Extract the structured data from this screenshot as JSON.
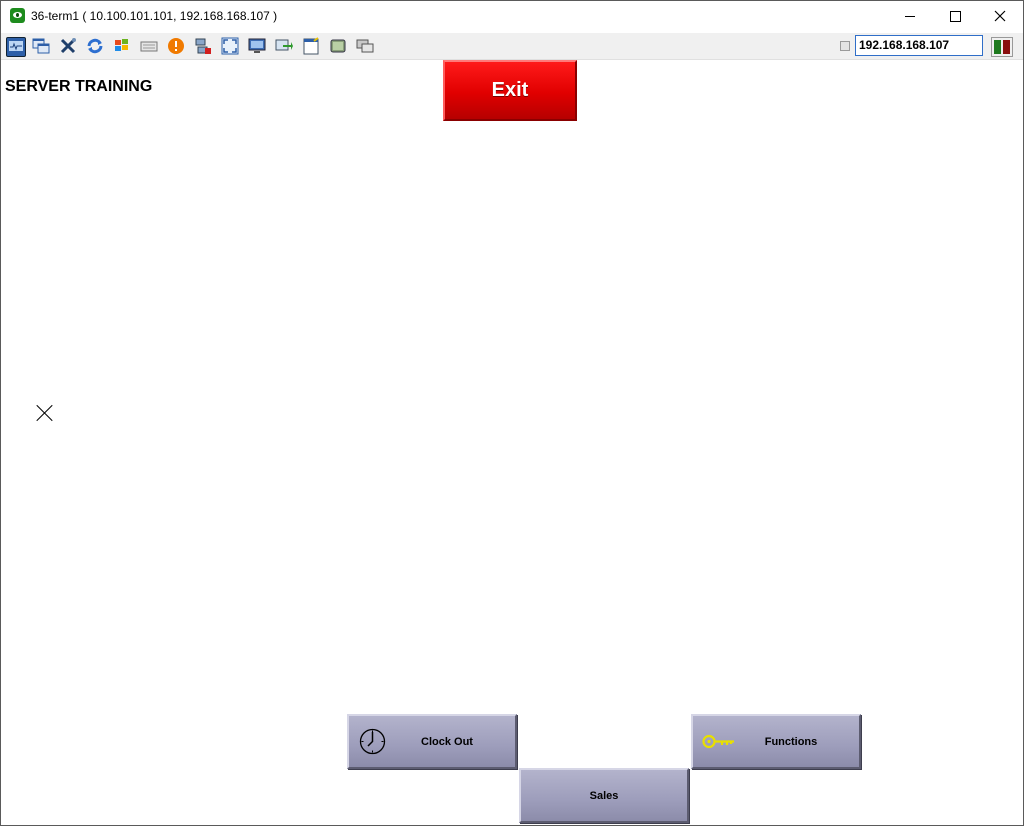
{
  "window": {
    "title": "36-term1 ( 10.100.101.101, 192.168.168.107 )"
  },
  "toolbar": {
    "icons": [
      "monitor-icon",
      "windows-icon",
      "tools-icon",
      "refresh-icon",
      "flag-icon",
      "keyboard-icon",
      "alert-icon",
      "network-icon",
      "fullscreen-icon",
      "display-icon",
      "transfer-icon",
      "notes-icon",
      "screen-icon",
      "chat-icon"
    ],
    "ip_value": "192.168.168.107"
  },
  "main": {
    "title": "SERVER TRAINING",
    "exit_label": "Exit"
  },
  "buttons": {
    "clock_out": "Clock Out",
    "functions": "Functions",
    "sales": "Sales"
  },
  "colors": {
    "exit": "#e00000",
    "pos_button": "#a3a3c2",
    "key_icon": "#e8e000"
  }
}
